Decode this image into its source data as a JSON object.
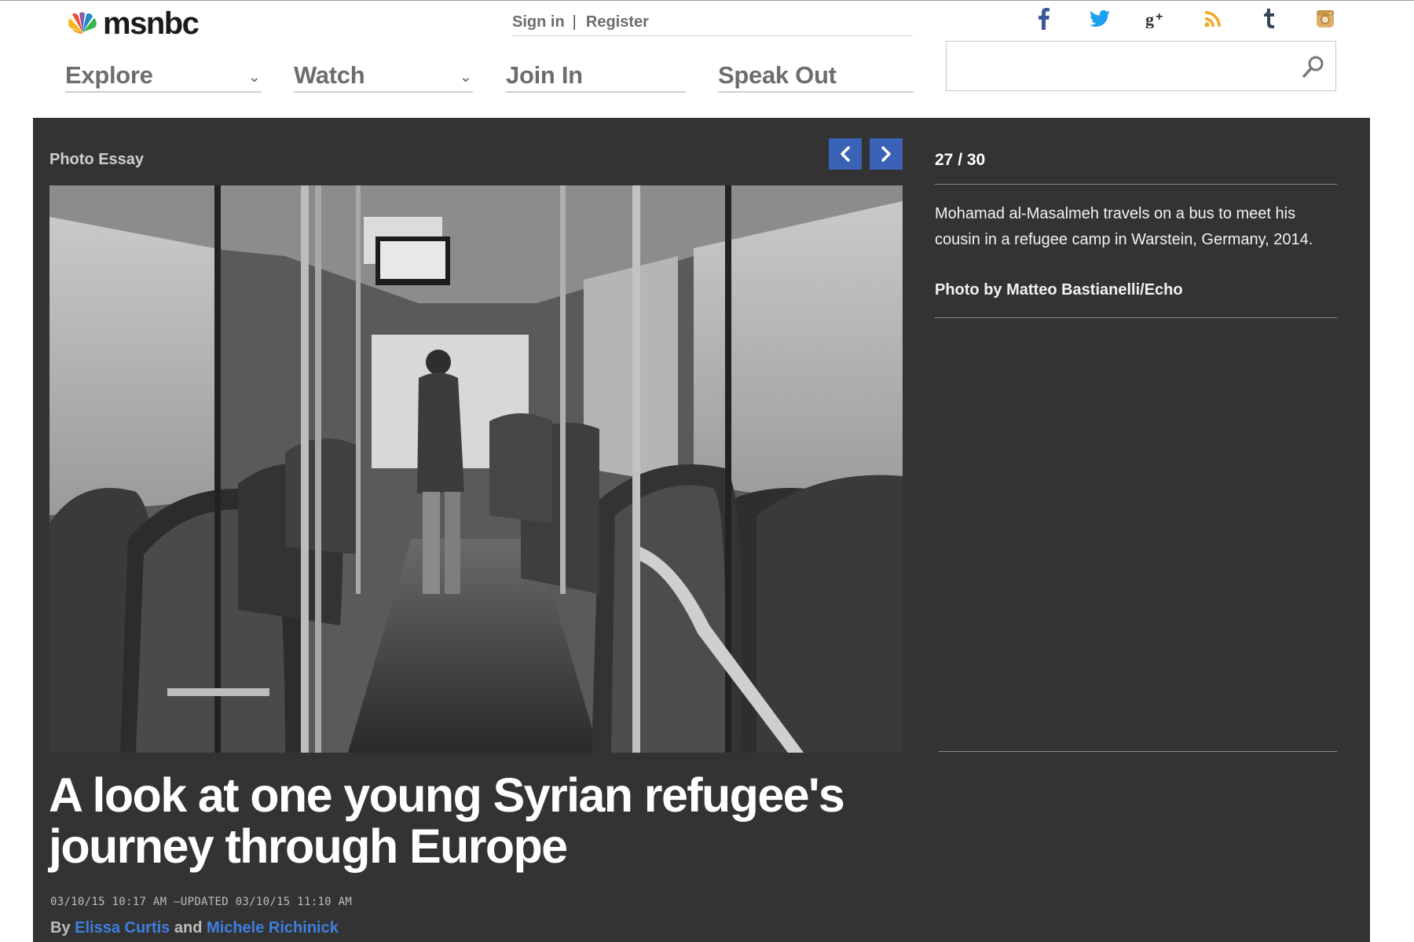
{
  "header": {
    "logo_text": "msnbc",
    "sign_in": "Sign in",
    "separator": "|",
    "register": "Register",
    "social_icons": [
      "facebook-icon",
      "twitter-icon",
      "google-plus-icon",
      "rss-icon",
      "tumblr-icon",
      "instagram-icon"
    ],
    "nav": [
      {
        "label": "Explore",
        "has_dropdown": true
      },
      {
        "label": "Watch",
        "has_dropdown": true
      },
      {
        "label": "Join In",
        "has_dropdown": false
      },
      {
        "label": "Speak Out",
        "has_dropdown": false
      }
    ],
    "chevron": "⌄",
    "search": {
      "value": "",
      "placeholder": ""
    }
  },
  "gallery": {
    "section_label": "Photo Essay",
    "current": 27,
    "total": 30,
    "counter_text": "27 / 30",
    "caption": "Mohamad al-Masalmeh travels on a bus to meet his cousin in a refugee camp in Warstein, Germany, 2014.",
    "credit": "Photo by Matteo Bastianelli/Echo",
    "prev_icon": "chevron-left-icon",
    "next_icon": "chevron-right-icon"
  },
  "article": {
    "headline": "A look at one young Syrian refugee's journey through Europe",
    "published": "03/10/15 10:17 AM",
    "dash": "–",
    "updated_label": "UPDATED",
    "updated": "03/10/15 11:10 AM",
    "by": "By",
    "author1": "Elissa Curtis",
    "and": "and",
    "author2": "Michele Richinick"
  },
  "colors": {
    "panel_bg": "#333333",
    "arrow_btn": "#3a63b8",
    "link": "#3f7fe0",
    "facebook": "#3b5998",
    "twitter": "#1da1f2",
    "rss": "#f5a623",
    "tumblr": "#35465c",
    "instagram": "#e0b068"
  }
}
